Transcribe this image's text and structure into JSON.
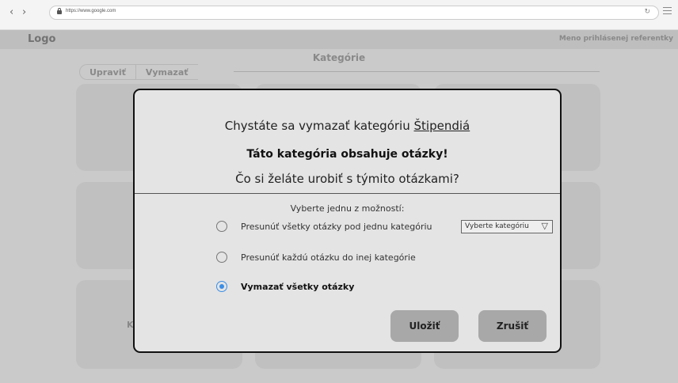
{
  "browser": {
    "url": "https://www.google.com",
    "back_icon": "chevron-left-icon",
    "forward_icon": "chevron-right-icon"
  },
  "header": {
    "logo": "Logo",
    "user": "Meno prihlásenej referentky"
  },
  "page": {
    "title": "Kategórie",
    "tabs": [
      "Upraviť",
      "Vymazať"
    ],
    "card_partial_text": "K"
  },
  "modal": {
    "line1_prefix": "Chystáte sa vymazať kategóriu ",
    "category_name": "Štipendiá",
    "warning": "Táto kategória obsahuje otázky!",
    "question": "Čo si želáte urobiť s týmito otázkami?",
    "choose_label": "Vyberte jednu z možností:",
    "options": [
      {
        "label": "Presunúť všetky otázky pod jednu kategóriu",
        "checked": false
      },
      {
        "label": "Presunúť každú otázku do inej kategórie",
        "checked": false
      },
      {
        "label": "Vymazať všetky otázky",
        "checked": true
      }
    ],
    "select_placeholder": "Vyberte kategóriu",
    "save_label": "Uložiť",
    "cancel_label": "Zrušiť"
  },
  "colors": {
    "accent": "#3a8ee6",
    "button": "#a8a8a8",
    "modal_bg": "#e4e4e4"
  }
}
